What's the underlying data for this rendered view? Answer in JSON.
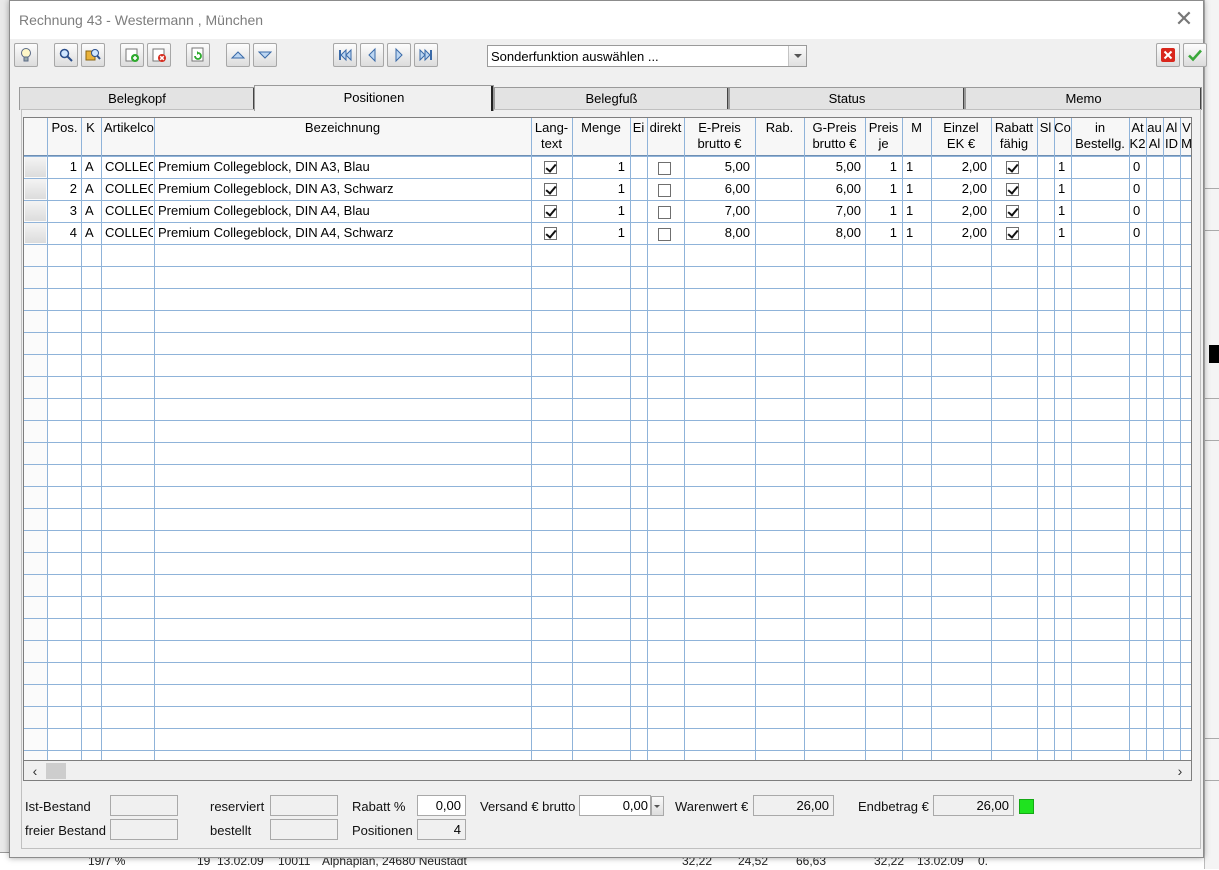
{
  "window": {
    "title": "Rechnung 43 - Westermann , München"
  },
  "toolbar": {
    "special_function_placeholder": "Sonderfunktion auswählen ..."
  },
  "tabs": [
    {
      "label": "Belegkopf"
    },
    {
      "label": "Positionen"
    },
    {
      "label": "Belegfuß"
    },
    {
      "label": "Status"
    },
    {
      "label": "Memo"
    }
  ],
  "grid": {
    "headers": [
      "Pos.",
      "K",
      "Artikelco",
      "Bezeichnung",
      "Lang-\ntext",
      "Menge",
      "Ei",
      "direkt",
      "E-Preis\nbrutto €",
      "Rab.",
      "G-Preis\nbrutto €",
      "Preis\nje",
      "M",
      "Einzel\nEK €",
      "Rabatt\nfähig",
      "Sl",
      "Co",
      "in\nBestellg.",
      "At\nK2",
      "au\nAl",
      "Al\nID",
      "V\nM"
    ],
    "rows": [
      {
        "pos": "1",
        "k": "A",
        "artikelcode": "COLLEG",
        "bezeichnung": "Premium Collegeblock, DIN A3, Blau",
        "langtext": true,
        "menge": "1",
        "direkt": false,
        "epreis": "5,00",
        "gpreis": "5,00",
        "preisje": "1",
        "m": "1",
        "einzelek": "2,00",
        "rabattfaehig": true,
        "co": "1",
        "atk2": "0"
      },
      {
        "pos": "2",
        "k": "A",
        "artikelcode": "COLLEG",
        "bezeichnung": "Premium Collegeblock, DIN A3, Schwarz",
        "langtext": true,
        "menge": "1",
        "direkt": false,
        "epreis": "6,00",
        "gpreis": "6,00",
        "preisje": "1",
        "m": "1",
        "einzelek": "2,00",
        "rabattfaehig": true,
        "co": "1",
        "atk2": "0"
      },
      {
        "pos": "3",
        "k": "A",
        "artikelcode": "COLLEG",
        "bezeichnung": "Premium Collegeblock, DIN A4, Blau",
        "langtext": true,
        "menge": "1",
        "direkt": false,
        "epreis": "7,00",
        "gpreis": "7,00",
        "preisje": "1",
        "m": "1",
        "einzelek": "2,00",
        "rabattfaehig": true,
        "co": "1",
        "atk2": "0"
      },
      {
        "pos": "4",
        "k": "A",
        "artikelcode": "COLLEG",
        "bezeichnung": "Premium Collegeblock, DIN A4, Schwarz",
        "langtext": true,
        "menge": "1",
        "direkt": false,
        "epreis": "8,00",
        "gpreis": "8,00",
        "preisje": "1",
        "m": "1",
        "einzelek": "2,00",
        "rabattfaehig": true,
        "co": "1",
        "atk2": "0"
      }
    ]
  },
  "footer": {
    "ist_bestand_label": "Ist-Bestand",
    "freier_bestand_label": "freier Bestand",
    "reserviert_label": "reserviert",
    "bestellt_label": "bestellt",
    "rabatt_label": "Rabatt %",
    "rabatt_value": "0,00",
    "positionen_label": "Positionen",
    "positionen_value": "4",
    "versand_label": "Versand € brutto",
    "versand_value": "0,00",
    "warenwert_label": "Warenwert €",
    "warenwert_value": "26,00",
    "endbetrag_label": "Endbetrag €",
    "endbetrag_value": "26,00",
    "status_color": "#1fe31f"
  },
  "background_app": {
    "row_text": [
      "19/7 %",
      "19",
      "13.02.09",
      "10011",
      "Alphaplan, 24680 Neustadt",
      "32,22",
      "24,52",
      "66,63",
      "32,22",
      "13.02.09",
      "0."
    ]
  }
}
